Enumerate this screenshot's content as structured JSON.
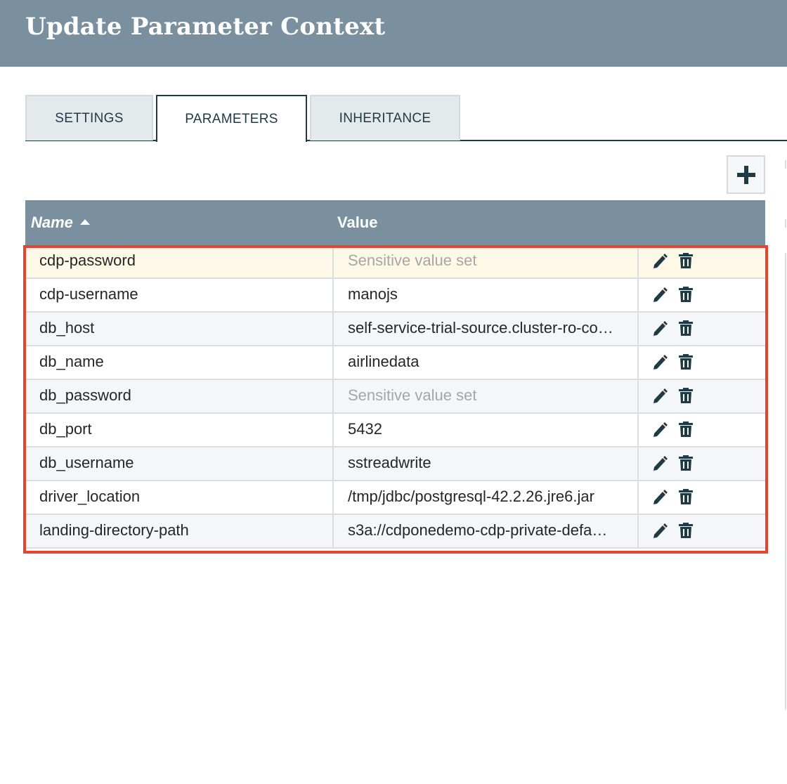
{
  "dialog": {
    "title": "Update Parameter Context"
  },
  "tabs": [
    {
      "label": "SETTINGS",
      "active": false
    },
    {
      "label": "PARAMETERS",
      "active": true
    },
    {
      "label": "INHERITANCE",
      "active": false
    }
  ],
  "toolbar": {
    "add_icon": "plus-icon"
  },
  "table": {
    "columns": {
      "name": "Name",
      "value": "Value"
    },
    "sort": {
      "column": "Name",
      "direction": "ascending"
    },
    "rows": [
      {
        "name": "cdp-password",
        "value": "Sensitive value set"
      },
      {
        "name": "cdp-username",
        "value": "manojs"
      },
      {
        "name": "db_host",
        "value": "self-service-trial-source.cluster-ro-co…"
      },
      {
        "name": "db_name",
        "value": "airlinedata"
      },
      {
        "name": "db_password",
        "value": "Sensitive value set"
      },
      {
        "name": "db_port",
        "value": "5432"
      },
      {
        "name": "db_username",
        "value": "sstreadwrite"
      },
      {
        "name": "driver_location",
        "value": "/tmp/jdbc/postgresql-42.2.26.jre6.jar"
      },
      {
        "name": "landing-directory-path",
        "value": "s3a://cdponedemo-cdp-private-defa…"
      }
    ],
    "row_action_icons": [
      "pencil-icon",
      "trash-icon"
    ]
  },
  "colors": {
    "header_bg": "#7a909e",
    "accent_dark": "#1f3a45",
    "highlight_red": "#e8432f",
    "selected_row": "#fdf9e6",
    "sensitive_text": "#a6a6a6"
  }
}
